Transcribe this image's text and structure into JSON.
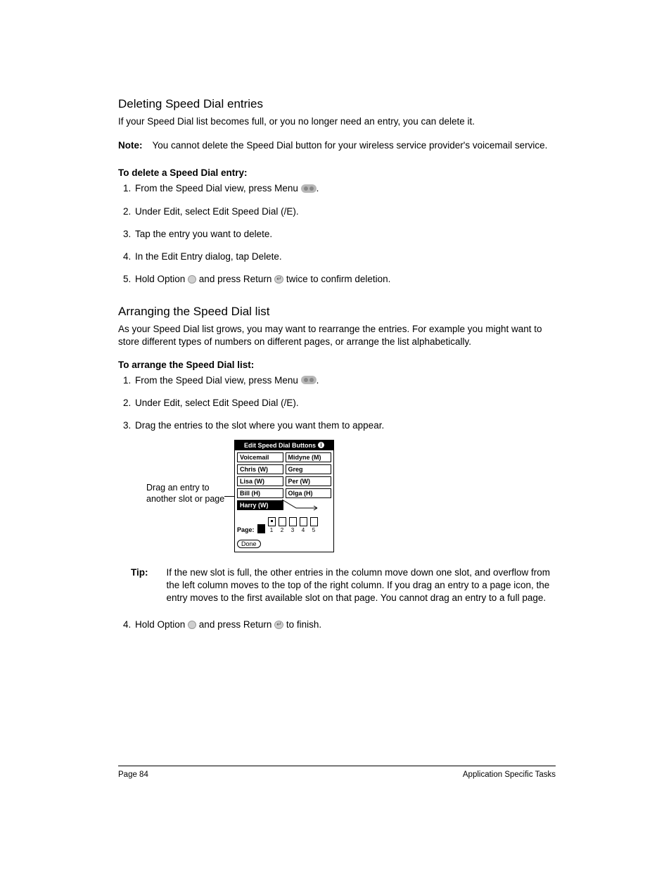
{
  "section1": {
    "title": "Deleting Speed Dial entries",
    "intro": "If your Speed Dial list becomes full, or you no longer need an entry, you can delete it.",
    "note_label": "Note:",
    "note_text": "You cannot delete the Speed Dial button for your wireless service provider's voicemail service.",
    "sub": "To delete a Speed Dial entry:",
    "steps": {
      "s1a": "From the Speed Dial view, press Menu ",
      "s1b": ".",
      "s2": "Under Edit, select Edit Speed Dial (/E).",
      "s3": "Tap the entry you want to delete.",
      "s4": "In the Edit Entry dialog, tap Delete.",
      "s5a": "Hold Option ",
      "s5b": " and press Return ",
      "s5c": " twice to confirm deletion."
    }
  },
  "section2": {
    "title": "Arranging the Speed Dial list",
    "intro": "As your Speed Dial list grows, you may want to rearrange the entries. For example you might want to store different types of numbers on different pages, or arrange the list alphabetically.",
    "sub": "To arrange the Speed Dial list:",
    "steps": {
      "s1a": "From the Speed Dial view, press Menu ",
      "s1b": ".",
      "s2": "Under Edit, select Edit Speed Dial (/E).",
      "s3": "Drag the entries to the slot where you want them to appear."
    },
    "callout": "Drag an entry to another slot or page",
    "tip_label": "Tip:",
    "tip_text": "If the new slot is full, the other entries in the column move down one slot, and overflow from the left column moves to the top of the right column. If you drag an entry to a page icon, the entry moves to the first available slot on that page. You cannot drag an entry to a full page.",
    "step4a": "Hold Option ",
    "step4b": " and press Return ",
    "step4c": " to finish."
  },
  "device": {
    "title": "Edit Speed Dial Buttons",
    "cells": {
      "r0c0": "Voicemail",
      "r0c1": "Midyne (M)",
      "r1c0": "Chris (W)",
      "r1c1": "Greg",
      "r2c0": "Lisa (W)",
      "r2c1": "Per (W)",
      "r3c0": "Bill (H)",
      "r3c1": "Olga (H)",
      "r4c0": "Harry (W)"
    },
    "page_label": "Page:",
    "pages": [
      "1",
      "2",
      "3",
      "4",
      "5"
    ],
    "done": "Done"
  },
  "footer": {
    "left": "Page 84",
    "right": "Application Specific Tasks"
  }
}
